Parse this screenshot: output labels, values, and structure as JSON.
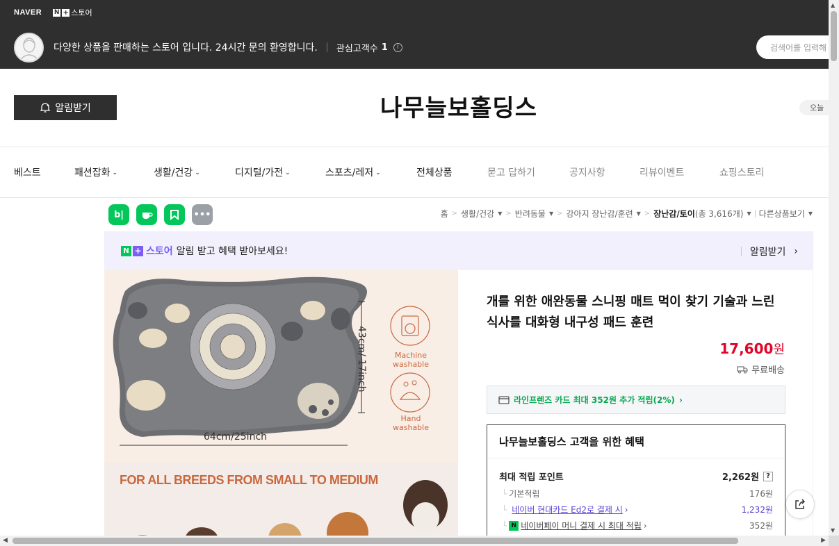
{
  "topbar": {
    "naver_logo": "NAVER",
    "nplus_store": "스토어",
    "store_description": "다양한 상품을 판매하는 스토어 입니다. 24시간 문의 환영합니다.",
    "interested_customers_label": "관심고객수",
    "interested_customers_count": "1",
    "search_placeholder": "검색어를 입력해"
  },
  "header": {
    "alarm_button": "알림받기",
    "store_name": "나무늘보홀딩스",
    "today_chip": "오늘"
  },
  "nav": {
    "items": [
      {
        "label": "베스트",
        "dropdown": false
      },
      {
        "label": "패션잡화",
        "dropdown": true
      },
      {
        "label": "생활/건강",
        "dropdown": true
      },
      {
        "label": "디지털/가전",
        "dropdown": true
      },
      {
        "label": "스포츠/레저",
        "dropdown": true
      },
      {
        "label": "전체상품",
        "dropdown": false
      },
      {
        "label": "묻고 답하기",
        "dropdown": false
      },
      {
        "label": "공지사항",
        "dropdown": false
      },
      {
        "label": "리뷰이벤트",
        "dropdown": false
      },
      {
        "label": "쇼핑스토리",
        "dropdown": false
      }
    ]
  },
  "share_icons": [
    "blog-icon",
    "talktalk-icon",
    "keep-icon",
    "more-icon"
  ],
  "breadcrumb": {
    "home": "홈",
    "level1": "생활/건강",
    "level2": "반려동물",
    "level3": "강아지 장난감/훈련",
    "current": "장난감/토이",
    "count_text": "(총 3,616개)",
    "other_products": "다른상품보기"
  },
  "promo": {
    "store_word": "스토어",
    "message": "알림 받고 혜택 받아보세요!",
    "action": "알림받기"
  },
  "product_image": {
    "height_label": "43cm/ 17inch",
    "width_label": "64cm/25inch",
    "machine_washable": "Machine washable",
    "hand_washable": "Hand washable",
    "breeds_text": "FOR ALL BREEDS FROM SMALL TO MEDIUM"
  },
  "product": {
    "title": "개를 위한 애완동물 스니핑 매트 먹이 찾기 기술과 느린 식사를 대화형 내구성 패드 훈련",
    "price_number": "17,600",
    "price_unit": "원",
    "shipping": "무료배송",
    "card_promo": "라인프렌즈 카드 최대 352원 추가 적립(2%)"
  },
  "benefit": {
    "title": "나무늘보홀딩스 고객을 위한 혜택",
    "max_points_label": "최대 적립 포인트",
    "max_points_value": "2,262원",
    "rows": [
      {
        "label": "기본적립",
        "value": "176원"
      },
      {
        "label": "네이버 현대카드 Ed2로 결제 시",
        "value": "1,232원"
      },
      {
        "label": "네이버페이 머니 결제 시 최대 적립",
        "value": "352원"
      }
    ]
  },
  "colors": {
    "topbar_bg": "#2f2f2f",
    "price_red": "#e1052a",
    "naver_green": "#03c75a",
    "purple": "#7b5cf5"
  }
}
